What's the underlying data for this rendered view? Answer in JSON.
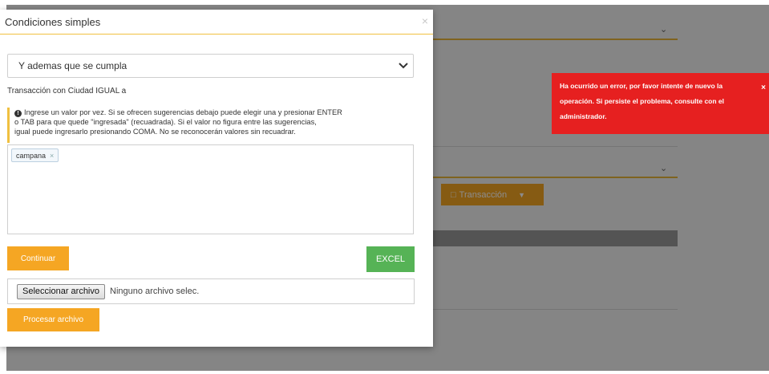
{
  "background": {
    "transaction_button_label": "Transacción"
  },
  "toast": {
    "lines": [
      "Ha ocurrido un error, por favor intente de nuevo la",
      "operación. Si persiste el problema, consulte con el",
      "administrador."
    ],
    "close_glyph": "×",
    "color": "#e62020"
  },
  "modal": {
    "title": "Condiciones simples",
    "close_glyph": "×",
    "select_value": "Y ademas que se cumpla",
    "condition_label": "Transacción con Ciudad IGUAL a",
    "hint_lines": [
      "Ingrese un valor por vez. Si se ofrecen sugerencias debajo puede elegir una y presionar ENTER",
      "o TAB para que quede \"ingresada\" (recuadrada). Si el valor no figura entre las sugerencias,",
      "igual puede ingresarlo presionando COMA. No se reconocerán valores sin recuadrar."
    ],
    "tags": [
      {
        "label": "campana",
        "remove_glyph": "×"
      }
    ],
    "continue_label": "Continuar",
    "excel_label": "EXCEL",
    "file_button_label": "Seleccionar archivo",
    "file_name": "Ninguno archivo selec.",
    "process_label": "Procesar archivo"
  },
  "colors": {
    "accent_orange": "#f5a623",
    "excel_green": "#56b356",
    "header_line": "#f0c040"
  }
}
